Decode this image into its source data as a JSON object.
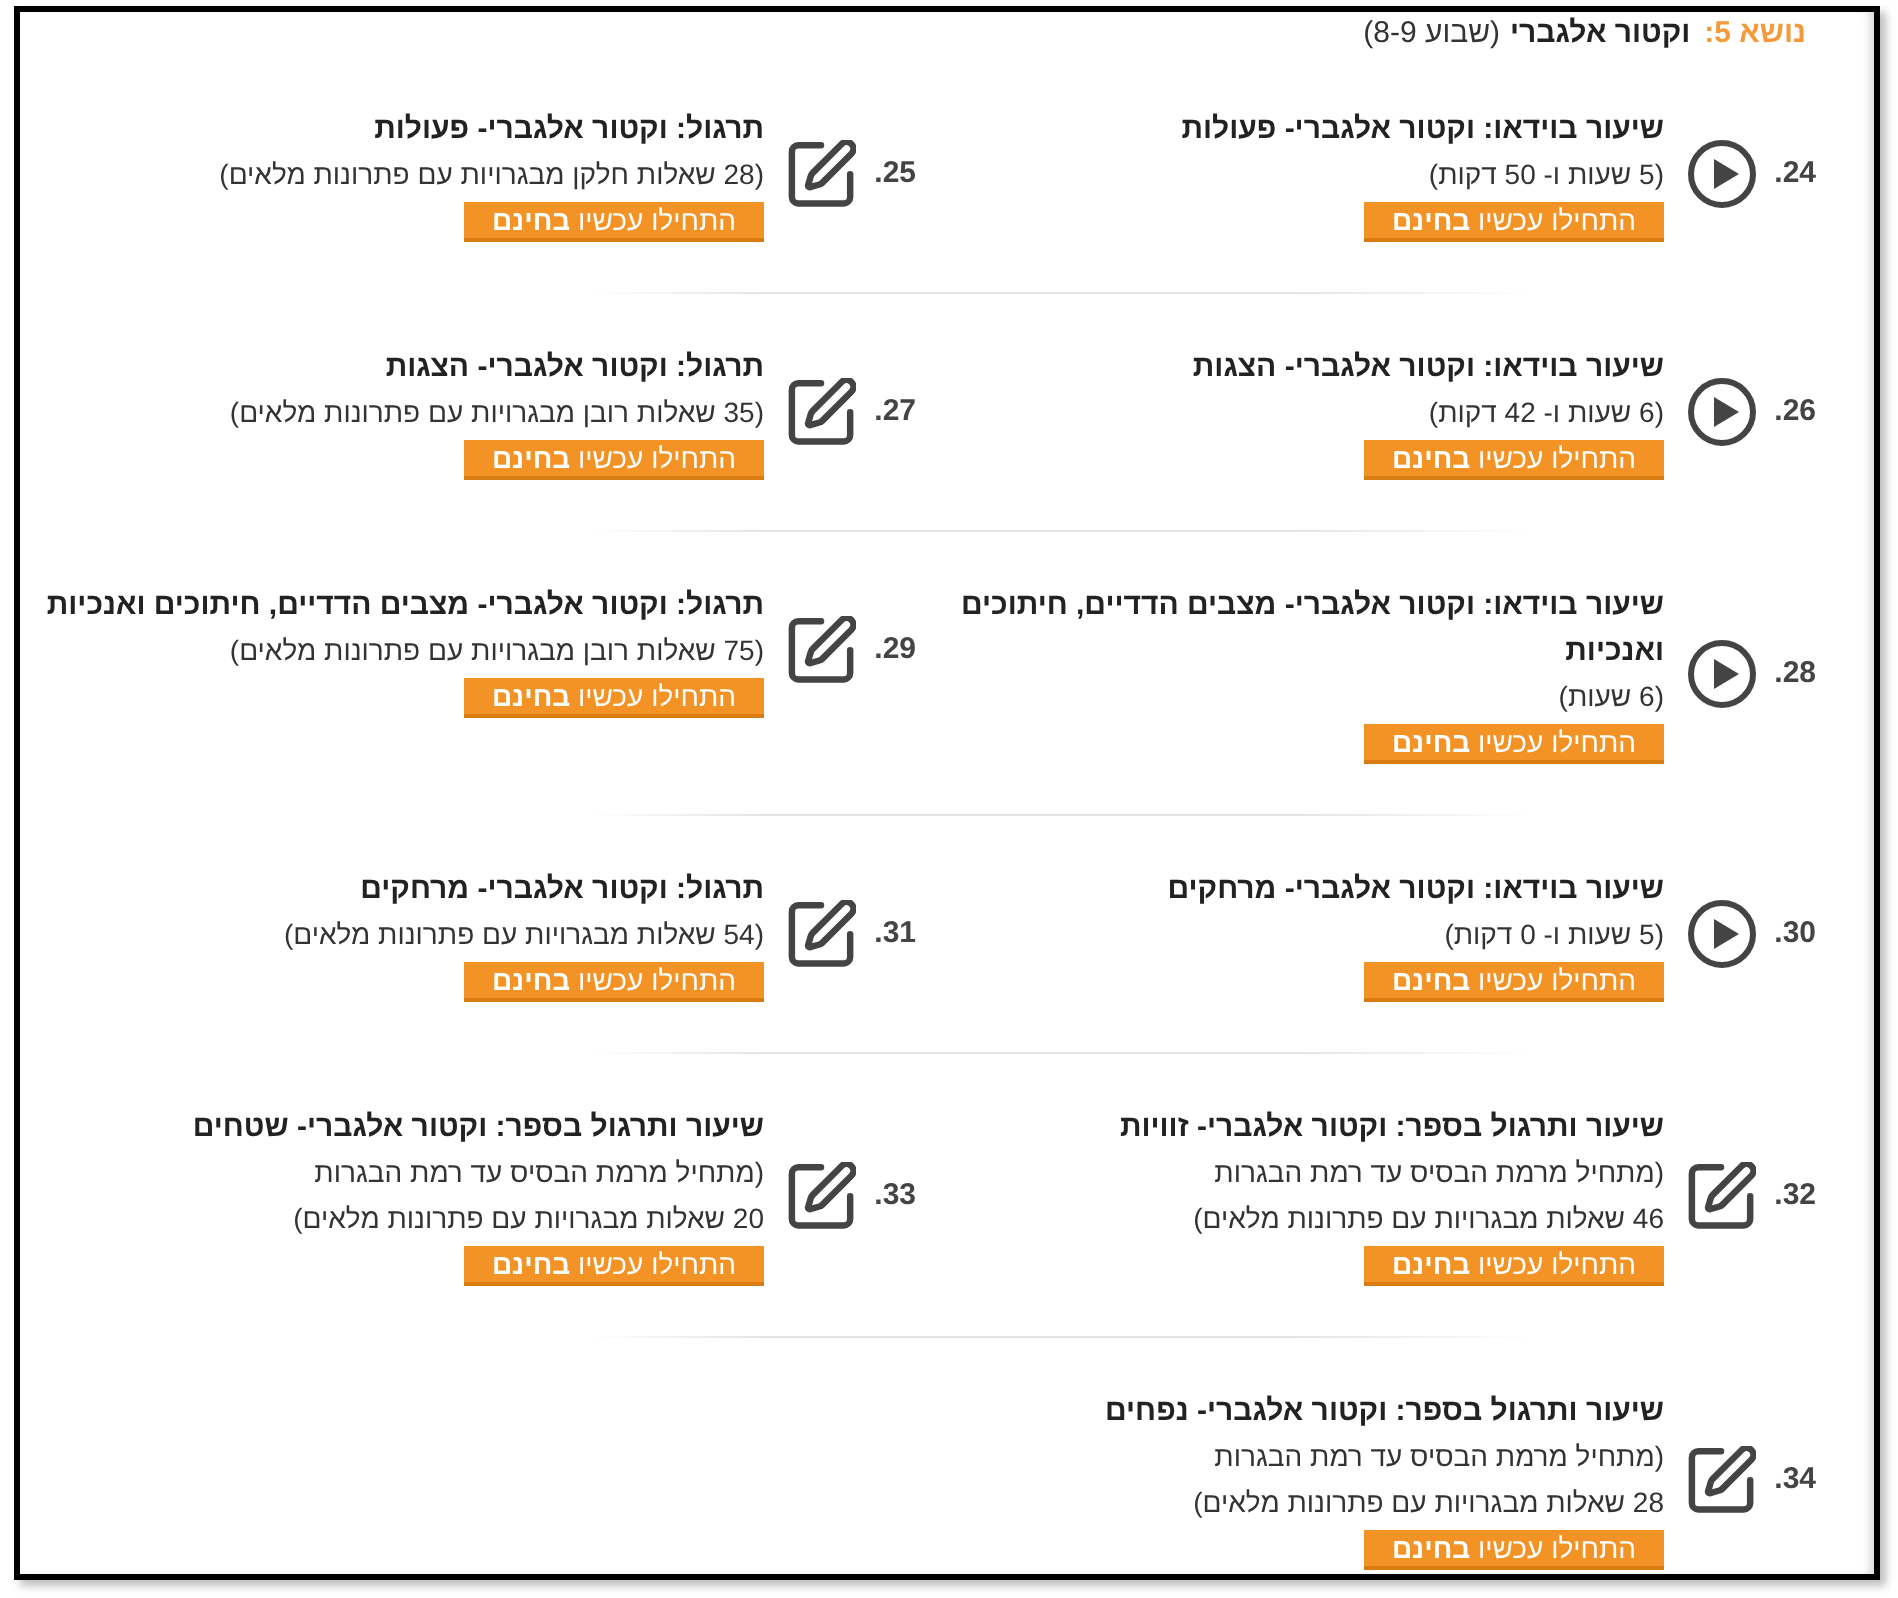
{
  "header": {
    "topic_label": "נושא 5:",
    "title": "וקטור אלגברי",
    "weeks": "(שבוע 8-9)"
  },
  "rows": [
    {
      "items": [
        {
          "number": "24.",
          "kind": "video",
          "title": "שיעור בוידאו: וקטור אלגברי- פעולות",
          "details": "(5 שעות ו- 50 דקות)",
          "button": "התחילו עכשיו **בחינם**"
        },
        {
          "number": "25.",
          "kind": "exercise",
          "title": "תרגול: וקטור אלגברי- פעולות",
          "details": "(28 שאלות חלקן מבגרויות עם פתרונות מלאים)",
          "button": "התחילו עכשיו **בחינם**"
        }
      ]
    },
    {
      "items": [
        {
          "number": "26.",
          "kind": "video",
          "title": "שיעור בוידאו: וקטור אלגברי- הצגות",
          "details": "(6 שעות ו- 42 דקות)",
          "button": "התחילו עכשיו **בחינם**"
        },
        {
          "number": "27.",
          "kind": "exercise",
          "title": "תרגול: וקטור אלגברי- הצגות",
          "details": "(35 שאלות רובן מבגרויות עם פתרונות מלאים)",
          "button": "התחילו עכשיו **בחינם**"
        }
      ]
    },
    {
      "items": [
        {
          "number": "28.",
          "kind": "video",
          "title": "שיעור בוידאו: וקטור אלגברי- מצבים הדדיים, חיתוכים ואנכיות",
          "details": "(6 שעות)",
          "button": "התחילו עכשיו **בחינם**"
        },
        {
          "number": "29.",
          "kind": "exercise",
          "title": "תרגול: וקטור אלגברי- מצבים הדדיים, חיתוכים ואנכיות",
          "details": "(75 שאלות רובן מבגרויות עם פתרונות מלאים)",
          "button": "התחילו עכשיו **בחינם**"
        }
      ]
    },
    {
      "items": [
        {
          "number": "30.",
          "kind": "video",
          "title": "שיעור בוידאו: וקטור אלגברי- מרחקים",
          "details": "(5 שעות ו- 0 דקות)",
          "button": "התחילו עכשיו **בחינם**"
        },
        {
          "number": "31.",
          "kind": "exercise",
          "title": "תרגול: וקטור אלגברי- מרחקים",
          "details": "(54 שאלות מבגרויות עם פתרונות מלאים)",
          "button": "התחילו עכשיו **בחינם**"
        }
      ]
    },
    {
      "items": [
        {
          "number": "32.",
          "kind": "exercise",
          "title": "שיעור ותרגול בספר: וקטור אלגברי- זוויות",
          "details": "(מתחיל מרמת הבסיס עד רמת הבגרות\n46 שאלות מבגרויות עם פתרונות מלאים)",
          "button": "התחילו עכשיו **בחינם**"
        },
        {
          "number": "33.",
          "kind": "exercise",
          "title": "שיעור ותרגול בספר: וקטור אלגברי- שטחים",
          "details": "(מתחיל מרמת הבסיס עד רמת הבגרות\n20 שאלות מבגרויות עם פתרונות מלאים)",
          "button": "התחילו עכשיו **בחינם**"
        }
      ]
    },
    {
      "items": [
        {
          "number": "34.",
          "kind": "exercise",
          "title": "שיעור ותרגול בספר: וקטור אלגברי- נפחים",
          "details": "(מתחיל מרמת הבסיס עד רמת הבגרות\n28 שאלות מבגרויות עם פתרונות מלאים)",
          "button": "התחילו עכשיו **בחינם**"
        }
      ]
    }
  ]
}
